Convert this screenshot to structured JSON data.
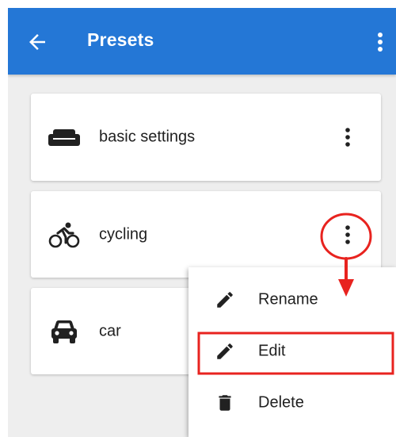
{
  "appbar": {
    "title": "Presets",
    "back_icon": "arrow-back-icon",
    "overflow_icon": "more-vert-icon",
    "background_color": "#2477d6"
  },
  "presets": [
    {
      "label": "basic settings",
      "icon": "sofa-icon",
      "menu_icon": "more-vert-icon"
    },
    {
      "label": "cycling",
      "icon": "bicycle-icon",
      "menu_icon": "more-vert-icon"
    },
    {
      "label": "car",
      "icon": "car-icon",
      "menu_icon": "more-vert-icon"
    }
  ],
  "context_menu": {
    "items": [
      {
        "label": "Rename",
        "icon": "pencil-icon"
      },
      {
        "label": "Edit",
        "icon": "pencil-icon",
        "highlighted": true
      },
      {
        "label": "Delete",
        "icon": "trash-icon"
      }
    ]
  },
  "annotation": {
    "color": "#e8231f",
    "circled": "cycling preset menu button",
    "arrow": "points down to context menu",
    "boxed": "Edit"
  }
}
